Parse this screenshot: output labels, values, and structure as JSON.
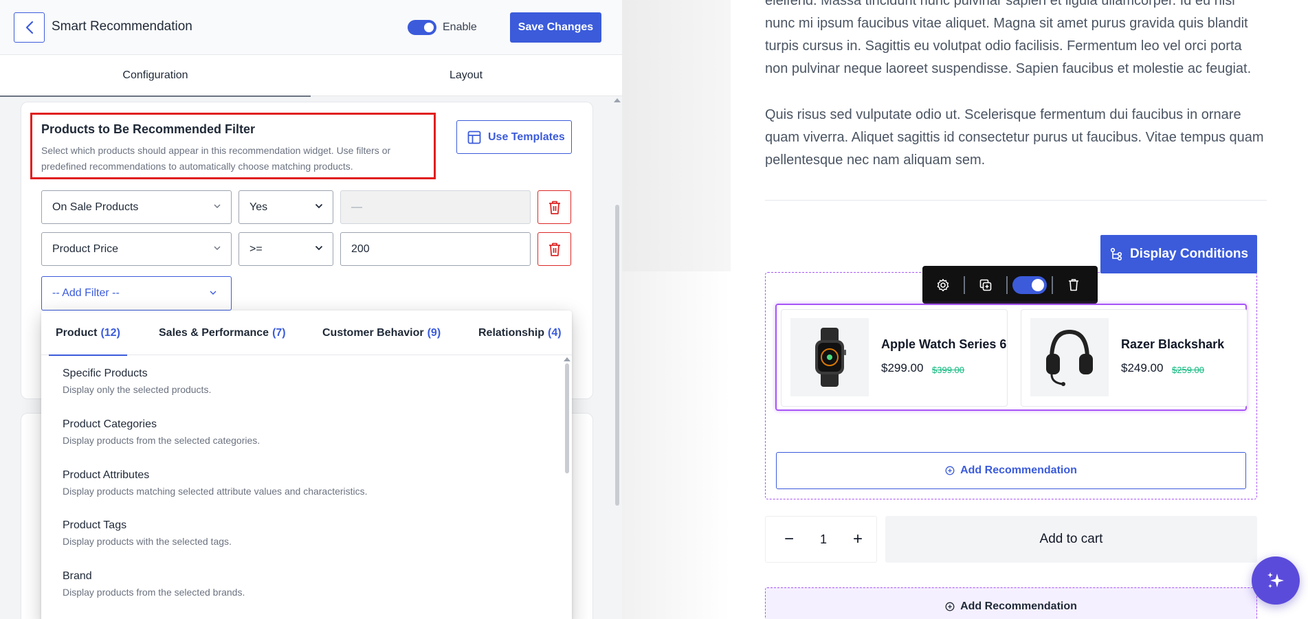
{
  "header": {
    "title": "Smart Recommendation",
    "enable_label": "Enable",
    "enable_on": true,
    "save_label": "Save Changes"
  },
  "tabs": [
    {
      "label": "Configuration",
      "active": true
    },
    {
      "label": "Layout",
      "active": false
    }
  ],
  "filter_section": {
    "title": "Products to Be Recommended Filter",
    "description": "Select which products should appear in this recommendation widget. Use filters or predefined recommendations to automatically choose matching products.",
    "use_templates_label": "Use Templates"
  },
  "filters": [
    {
      "field": "On Sale Products",
      "operator": "Yes",
      "value": "—",
      "value_disabled": true
    },
    {
      "field": "Product Price",
      "operator": ">=",
      "value": "200",
      "value_disabled": false
    }
  ],
  "add_filter_placeholder": "-- Add Filter --",
  "dropdown": {
    "tabs": [
      {
        "label": "Product",
        "count": "(12)"
      },
      {
        "label": "Sales & Performance",
        "count": "(7)"
      },
      {
        "label": "Customer Behavior",
        "count": "(9)"
      },
      {
        "label": "Relationship",
        "count": "(4)"
      }
    ],
    "items": [
      {
        "name": "Specific Products",
        "desc": "Display only the selected products."
      },
      {
        "name": "Product Categories",
        "desc": "Display products from the selected categories."
      },
      {
        "name": "Product Attributes",
        "desc": "Display products matching selected attribute values and characteristics."
      },
      {
        "name": "Product Tags",
        "desc": "Display products with the selected tags."
      },
      {
        "name": "Brand",
        "desc": "Display products from the selected brands."
      }
    ]
  },
  "preview": {
    "paragraph_1": "eleifend. Massa tincidunt nunc pulvinar sapien et ligula ullamcorper. Id eu nisl nunc mi ipsum faucibus vitae aliquet. Magna sit amet purus gravida quis blandit turpis cursus in. Sagittis eu volutpat odio facilisis. Fermentum leo vel orci porta non pulvinar neque laoreet suspendisse. Sapien faucibus et molestie ac feugiat.",
    "paragraph_2": "Quis risus sed vulputate odio ut. Scelerisque fermentum dui faucibus in ornare quam viverra. Aliquet sagittis id consectetur purus ut faucibus. Vitae tempus quam pellentesque nec nam aliquam sem.",
    "display_conditions_label": "Display Conditions",
    "widget_toggle_on": true,
    "products": [
      {
        "name": "Apple Watch Series 6",
        "price": "$299.00",
        "old_price": "$399.00",
        "icon": "smartwatch-image"
      },
      {
        "name": "Razer Blackshark",
        "price": "$249.00",
        "old_price": "$259.00",
        "icon": "headset-image"
      }
    ],
    "add_recommendation_label": "Add Recommendation",
    "quantity": "1",
    "add_to_cart_label": "Add to cart",
    "add_recommendation_label_2": "Add Recommendation"
  },
  "colors": {
    "accent": "#3b5bdb",
    "danger": "#dc2626",
    "highlight": "#e11d1d",
    "widget_outline": "#a855f7",
    "sale_price": "#10b981"
  }
}
